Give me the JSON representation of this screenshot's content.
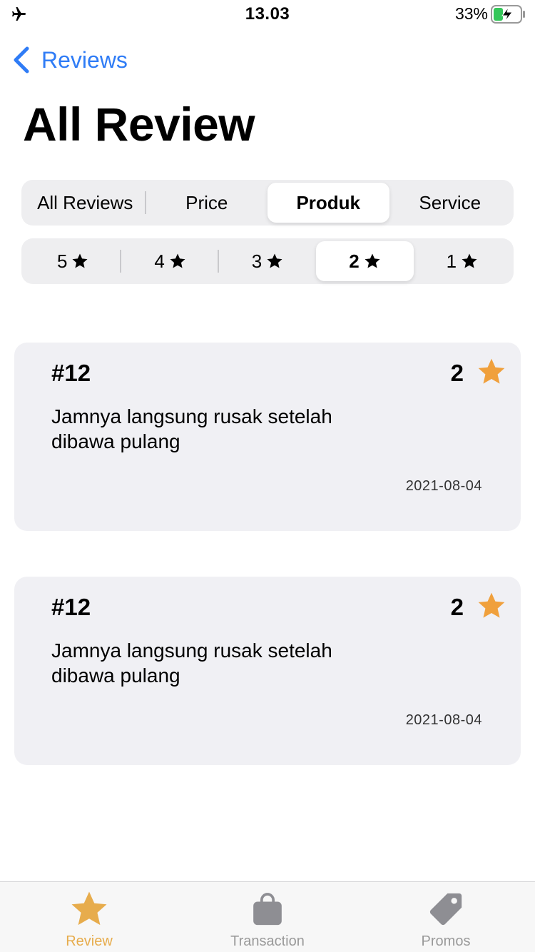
{
  "status_bar": {
    "time": "13.03",
    "battery": "33%"
  },
  "nav": {
    "back_label": "Reviews",
    "title": "All Review"
  },
  "category_tabs": [
    {
      "label": "All Reviews",
      "selected": false
    },
    {
      "label": "Price",
      "selected": false
    },
    {
      "label": "Produk",
      "selected": true
    },
    {
      "label": "Service",
      "selected": false
    }
  ],
  "star_filters": [
    {
      "label": "5",
      "selected": false
    },
    {
      "label": "4",
      "selected": false
    },
    {
      "label": "3",
      "selected": false
    },
    {
      "label": "2",
      "selected": true
    },
    {
      "label": "1",
      "selected": false
    }
  ],
  "reviews": [
    {
      "id": "#12",
      "rating": "2",
      "text": "Jamnya langsung rusak setelah dibawa pulang",
      "date": "2021-08-04"
    },
    {
      "id": "#12",
      "rating": "2",
      "text": "Jamnya langsung rusak setelah dibawa pulang",
      "date": "2021-08-04"
    }
  ],
  "tab_bar": [
    {
      "label": "Review",
      "icon": "star-icon",
      "active": true
    },
    {
      "label": "Transaction",
      "icon": "bag-icon",
      "active": false
    },
    {
      "label": "Promos",
      "icon": "tag-icon",
      "active": false
    }
  ],
  "colors": {
    "accent_blue": "#2f7cf6",
    "star_orange": "#f0a03c",
    "tab_active": "#e7ac4c",
    "tab_inactive": "#999999"
  }
}
